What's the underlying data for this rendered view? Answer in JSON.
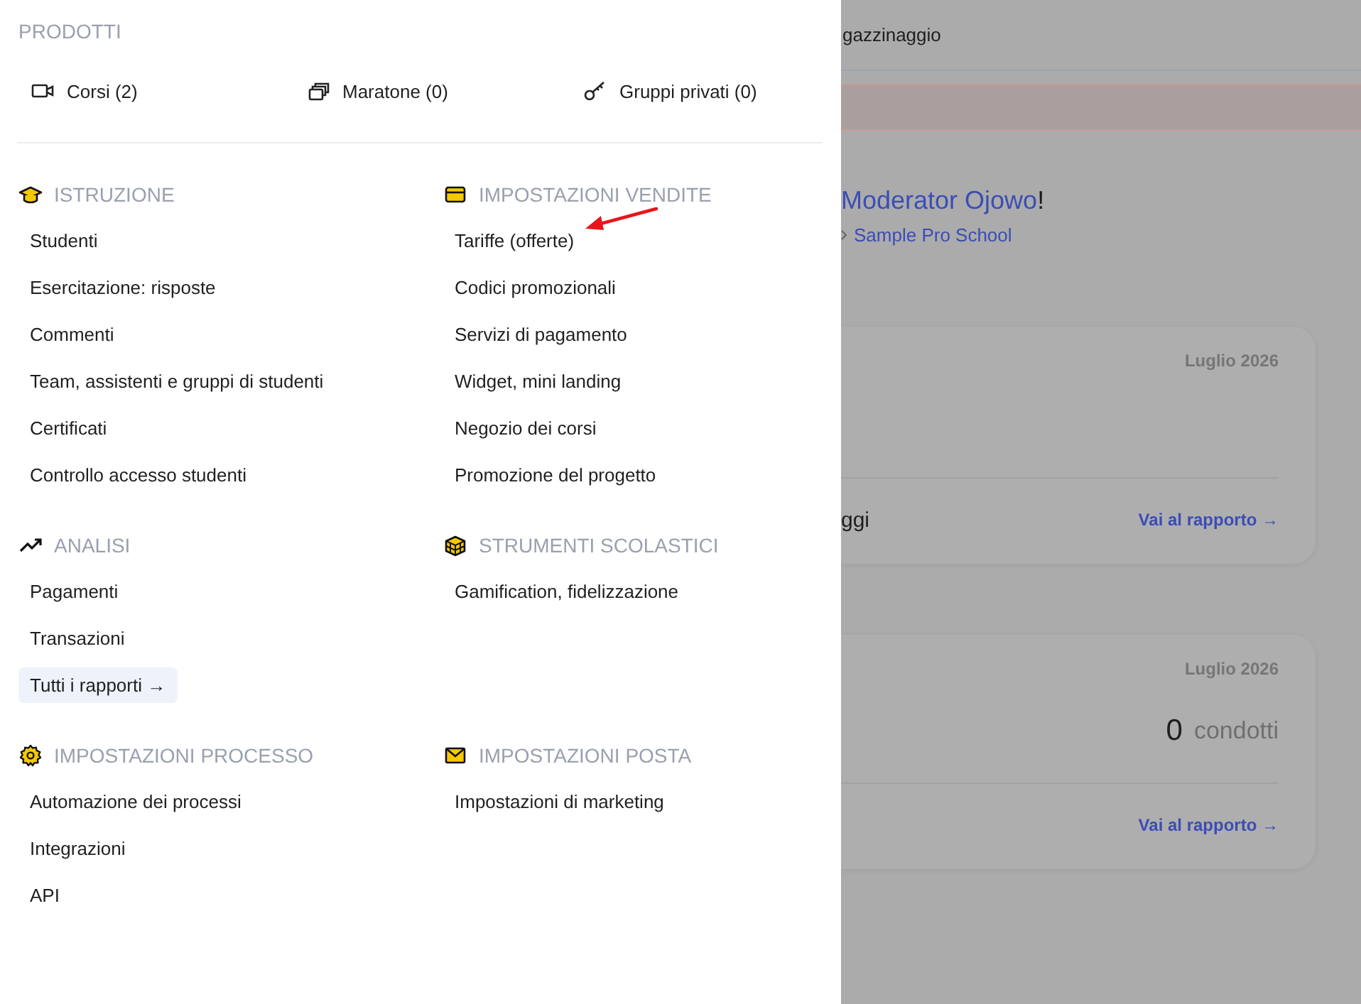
{
  "menu": {
    "products_title": "PRODOTTI",
    "products": [
      {
        "label": "Corsi (2)"
      },
      {
        "label": "Maratone (0)"
      },
      {
        "label": "Gruppi privati (0)"
      }
    ],
    "sections": [
      {
        "title": "ISTRUZIONE",
        "items": [
          {
            "label": "Studenti",
            "kind": "item",
            "marked": false
          },
          {
            "label": "Esercitazione: risposte",
            "kind": "item",
            "marked": false
          },
          {
            "label": "Commenti",
            "kind": "item",
            "marked": false
          },
          {
            "label": "Team, assistenti e gruppi di studenti",
            "kind": "item",
            "marked": false
          },
          {
            "label": "Certificati",
            "kind": "item",
            "marked": false
          },
          {
            "label": "Controllo accesso studenti",
            "kind": "item",
            "marked": false
          }
        ]
      },
      {
        "title": "IMPOSTAZIONI VENDITE",
        "items": [
          {
            "label": "Tariffe (offerte)",
            "kind": "item",
            "marked": true
          },
          {
            "label": "Codici promozionali",
            "kind": "item",
            "marked": false
          },
          {
            "label": "Servizi di pagamento",
            "kind": "item",
            "marked": false
          },
          {
            "label": "Widget, mini landing",
            "kind": "item",
            "marked": false
          },
          {
            "label": "Negozio dei corsi",
            "kind": "item",
            "marked": false
          },
          {
            "label": "Promozione del progetto",
            "kind": "item",
            "marked": false
          }
        ]
      },
      {
        "title": "ANALISI",
        "items": [
          {
            "label": "Pagamenti",
            "kind": "item",
            "marked": false
          },
          {
            "label": "Transazioni",
            "kind": "item",
            "marked": false
          },
          {
            "label": "Tutti i rapporti →",
            "kind": "link",
            "marked": false
          }
        ]
      },
      {
        "title": "STRUMENTI SCOLASTICI",
        "items": [
          {
            "label": "Gamification, fidelizzazione",
            "kind": "item",
            "marked": false
          }
        ]
      },
      {
        "title": "IMPOSTAZIONI PROCESSO",
        "items": [
          {
            "label": "Automazione dei processi",
            "kind": "item",
            "marked": false
          },
          {
            "label": "Integrazioni",
            "kind": "item",
            "marked": false
          },
          {
            "label": "API",
            "kind": "item",
            "marked": false
          }
        ]
      },
      {
        "title": "IMPOSTAZIONI POSTA",
        "items": [
          {
            "label": "Impostazioni di marketing",
            "kind": "item",
            "marked": false
          }
        ]
      }
    ]
  },
  "backdrop": {
    "top_bar": {
      "text": "gazzinaggio"
    },
    "alert": {
      "kind": "error"
    },
    "greeting": {
      "name": "Moderator Ojowo",
      "punctuation": "!"
    },
    "breadcrumb": {
      "school": "Sample Pro School"
    },
    "cards": [
      {
        "period": "Luglio 2026",
        "title": "ggi",
        "link": "Vai al rapporto →"
      },
      {
        "period": "Luglio 2026",
        "count": "0",
        "unit": "condotti",
        "link": "Vai al rapporto →"
      }
    ]
  }
}
